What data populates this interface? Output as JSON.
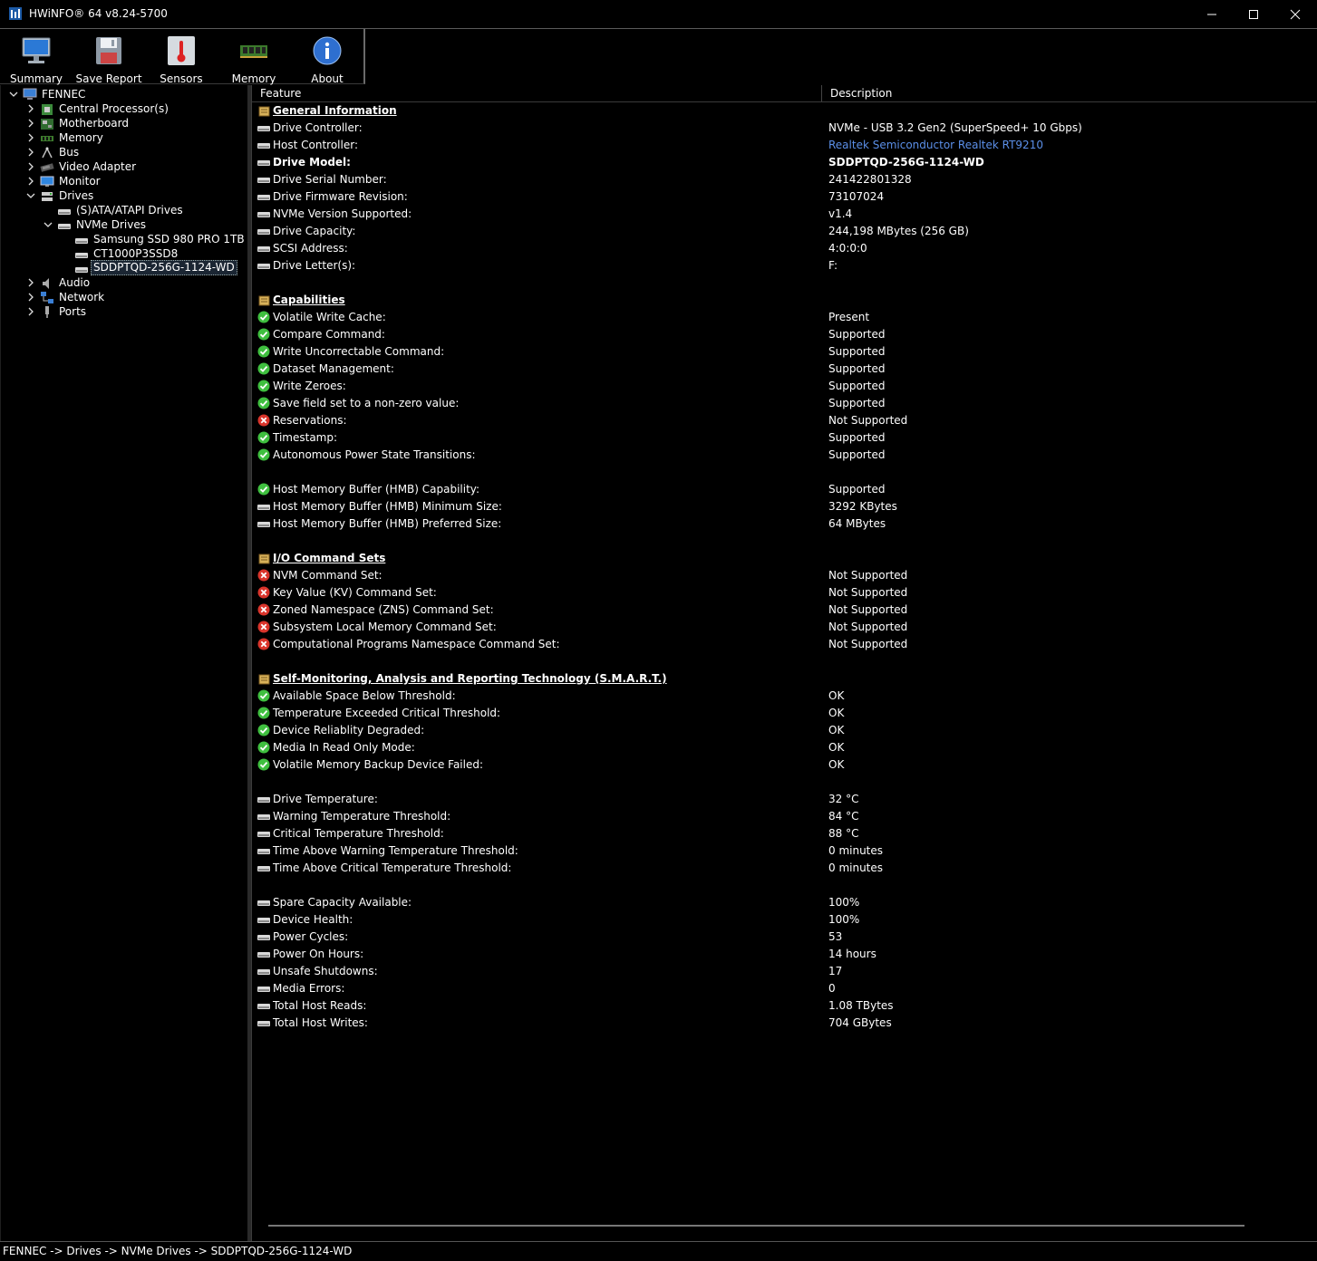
{
  "window": {
    "title": "HWiNFO® 64 v8.24-5700"
  },
  "toolbar": {
    "buttons": [
      {
        "label": "Summary",
        "icon": "monitor-icon"
      },
      {
        "label": "Save Report",
        "icon": "floppy-disk-icon"
      },
      {
        "label": "Sensors",
        "icon": "thermometer-icon"
      },
      {
        "label": "Memory",
        "icon": "memory-module-icon"
      },
      {
        "label": "About",
        "icon": "info-icon"
      }
    ]
  },
  "tree": {
    "items": [
      {
        "label": "FENNEC",
        "level": 0,
        "expanded": true,
        "icon": "computer-icon"
      },
      {
        "label": "Central Processor(s)",
        "level": 1,
        "expanded": false,
        "icon": "cpu-icon"
      },
      {
        "label": "Motherboard",
        "level": 1,
        "expanded": false,
        "icon": "motherboard-icon"
      },
      {
        "label": "Memory",
        "level": 1,
        "expanded": false,
        "icon": "memory-icon"
      },
      {
        "label": "Bus",
        "level": 1,
        "expanded": false,
        "icon": "bus-icon"
      },
      {
        "label": "Video Adapter",
        "level": 1,
        "expanded": false,
        "icon": "video-adapter-icon"
      },
      {
        "label": "Monitor",
        "level": 1,
        "expanded": false,
        "icon": "monitor-icon"
      },
      {
        "label": "Drives",
        "level": 1,
        "expanded": true,
        "icon": "drives-icon"
      },
      {
        "label": "(S)ATA/ATAPI Drives",
        "level": 2,
        "expanded": null,
        "icon": "drive-icon"
      },
      {
        "label": "NVMe Drives",
        "level": 2,
        "expanded": true,
        "icon": "drive-icon"
      },
      {
        "label": "Samsung SSD 980 PRO 1TB",
        "level": 3,
        "expanded": null,
        "icon": "drive-icon"
      },
      {
        "label": "CT1000P3SSD8",
        "level": 3,
        "expanded": null,
        "icon": "drive-icon"
      },
      {
        "label": "SDDPTQD-256G-1124-WD",
        "level": 3,
        "expanded": null,
        "icon": "drive-icon",
        "selected": true
      },
      {
        "label": "Audio",
        "level": 1,
        "expanded": false,
        "icon": "audio-icon"
      },
      {
        "label": "Network",
        "level": 1,
        "expanded": false,
        "icon": "network-icon"
      },
      {
        "label": "Ports",
        "level": 1,
        "expanded": false,
        "icon": "ports-icon"
      }
    ]
  },
  "detail": {
    "columns": {
      "feature": "Feature",
      "description": "Description"
    },
    "rows": [
      {
        "kind": "section",
        "feature": "General Information",
        "desc": "",
        "icon": "section-icon"
      },
      {
        "kind": "item",
        "feature": "Drive Controller:",
        "desc": "NVMe - USB 3.2 Gen2 (SuperSpeed+ 10 Gbps)",
        "icon": "drive-icon"
      },
      {
        "kind": "item",
        "feature": "Host Controller:",
        "desc": "Realtek Semiconductor Realtek RT9210",
        "icon": "drive-icon",
        "link": true
      },
      {
        "kind": "bold",
        "feature": "Drive Model:",
        "desc": "SDDPTQD-256G-1124-WD",
        "icon": "drive-icon"
      },
      {
        "kind": "item",
        "feature": "Drive Serial Number:",
        "desc": "241422801328",
        "icon": "drive-icon"
      },
      {
        "kind": "item",
        "feature": "Drive Firmware Revision:",
        "desc": "73107024",
        "icon": "drive-icon"
      },
      {
        "kind": "item",
        "feature": "NVMe Version Supported:",
        "desc": "v1.4",
        "icon": "drive-icon"
      },
      {
        "kind": "item",
        "feature": "Drive Capacity:",
        "desc": "244,198 MBytes (256 GB)",
        "icon": "drive-icon"
      },
      {
        "kind": "item",
        "feature": "SCSI Address:",
        "desc": "4:0:0:0",
        "icon": "drive-icon"
      },
      {
        "kind": "item",
        "feature": "Drive Letter(s):",
        "desc": "F:",
        "icon": "drive-icon"
      },
      {
        "kind": "blank"
      },
      {
        "kind": "section",
        "feature": "Capabilities",
        "desc": "",
        "icon": "section-icon"
      },
      {
        "kind": "item",
        "feature": "Volatile Write Cache:",
        "desc": "Present",
        "icon": "check-icon"
      },
      {
        "kind": "item",
        "feature": "Compare Command:",
        "desc": "Supported",
        "icon": "check-icon"
      },
      {
        "kind": "item",
        "feature": "Write Uncorrectable Command:",
        "desc": "Supported",
        "icon": "check-icon"
      },
      {
        "kind": "item",
        "feature": "Dataset Management:",
        "desc": "Supported",
        "icon": "check-icon"
      },
      {
        "kind": "item",
        "feature": "Write Zeroes:",
        "desc": "Supported",
        "icon": "check-icon"
      },
      {
        "kind": "item",
        "feature": "Save field set to a non-zero value:",
        "desc": "Supported",
        "icon": "check-icon"
      },
      {
        "kind": "item",
        "feature": "Reservations:",
        "desc": "Not Supported",
        "icon": "cross-icon"
      },
      {
        "kind": "item",
        "feature": "Timestamp:",
        "desc": "Supported",
        "icon": "check-icon"
      },
      {
        "kind": "item",
        "feature": "Autonomous Power State Transitions:",
        "desc": "Supported",
        "icon": "check-icon"
      },
      {
        "kind": "blank"
      },
      {
        "kind": "item",
        "feature": "Host Memory Buffer (HMB) Capability:",
        "desc": "Supported",
        "icon": "check-icon"
      },
      {
        "kind": "item",
        "feature": "Host Memory Buffer (HMB) Minimum Size:",
        "desc": "3292 KBytes",
        "icon": "drive-icon"
      },
      {
        "kind": "item",
        "feature": "Host Memory Buffer (HMB) Preferred Size:",
        "desc": "64 MBytes",
        "icon": "drive-icon"
      },
      {
        "kind": "blank"
      },
      {
        "kind": "section",
        "feature": "I/O Command Sets",
        "desc": "",
        "icon": "section-icon"
      },
      {
        "kind": "item",
        "feature": "NVM Command Set:",
        "desc": "Not Supported",
        "icon": "cross-icon"
      },
      {
        "kind": "item",
        "feature": "Key Value (KV) Command Set:",
        "desc": "Not Supported",
        "icon": "cross-icon"
      },
      {
        "kind": "item",
        "feature": "Zoned Namespace (ZNS) Command Set:",
        "desc": "Not Supported",
        "icon": "cross-icon"
      },
      {
        "kind": "item",
        "feature": "Subsystem Local Memory Command Set:",
        "desc": "Not Supported",
        "icon": "cross-icon"
      },
      {
        "kind": "item",
        "feature": "Computational Programs Namespace Command Set:",
        "desc": "Not Supported",
        "icon": "cross-icon"
      },
      {
        "kind": "blank"
      },
      {
        "kind": "section",
        "feature": "Self-Monitoring, Analysis and Reporting Technology (S.M.A.R.T.)",
        "desc": "",
        "icon": "section-icon"
      },
      {
        "kind": "item",
        "feature": "Available Space Below Threshold:",
        "desc": "OK",
        "icon": "check-icon"
      },
      {
        "kind": "item",
        "feature": "Temperature Exceeded Critical Threshold:",
        "desc": "OK",
        "icon": "check-icon"
      },
      {
        "kind": "item",
        "feature": "Device Reliablity Degraded:",
        "desc": "OK",
        "icon": "check-icon"
      },
      {
        "kind": "item",
        "feature": "Media In Read Only Mode:",
        "desc": "OK",
        "icon": "check-icon"
      },
      {
        "kind": "item",
        "feature": "Volatile Memory Backup Device Failed:",
        "desc": "OK",
        "icon": "check-icon"
      },
      {
        "kind": "blank"
      },
      {
        "kind": "item",
        "feature": "Drive Temperature:",
        "desc": "32 °C",
        "icon": "drive-icon"
      },
      {
        "kind": "item",
        "feature": "Warning Temperature Threshold:",
        "desc": "84 °C",
        "icon": "drive-icon"
      },
      {
        "kind": "item",
        "feature": "Critical Temperature Threshold:",
        "desc": "88 °C",
        "icon": "drive-icon"
      },
      {
        "kind": "item",
        "feature": "Time Above Warning Temperature Threshold:",
        "desc": "0 minutes",
        "icon": "drive-icon"
      },
      {
        "kind": "item",
        "feature": "Time Above Critical Temperature Threshold:",
        "desc": "0 minutes",
        "icon": "drive-icon"
      },
      {
        "kind": "blank"
      },
      {
        "kind": "item",
        "feature": "Spare Capacity Available:",
        "desc": "100%",
        "icon": "drive-icon"
      },
      {
        "kind": "item",
        "feature": "Device Health:",
        "desc": "100%",
        "icon": "drive-icon"
      },
      {
        "kind": "item",
        "feature": "Power Cycles:",
        "desc": "53",
        "icon": "drive-icon"
      },
      {
        "kind": "item",
        "feature": "Power On Hours:",
        "desc": "14 hours",
        "icon": "drive-icon"
      },
      {
        "kind": "item",
        "feature": "Unsafe Shutdowns:",
        "desc": "17",
        "icon": "drive-icon"
      },
      {
        "kind": "item",
        "feature": "Media Errors:",
        "desc": "0",
        "icon": "drive-icon"
      },
      {
        "kind": "item",
        "feature": "Total Host Reads:",
        "desc": "1.08 TBytes",
        "icon": "drive-icon"
      },
      {
        "kind": "item",
        "feature": "Total Host Writes:",
        "desc": "704 GBytes",
        "icon": "drive-icon"
      }
    ]
  },
  "status": {
    "path": "FENNEC -> Drives -> NVMe Drives -> SDDPTQD-256G-1124-WD"
  },
  "colors": {
    "background": "#000000",
    "link": "#5b8fe8",
    "check": "#3fbf3f",
    "cross": "#d9342b",
    "selection": "#1b2633"
  }
}
